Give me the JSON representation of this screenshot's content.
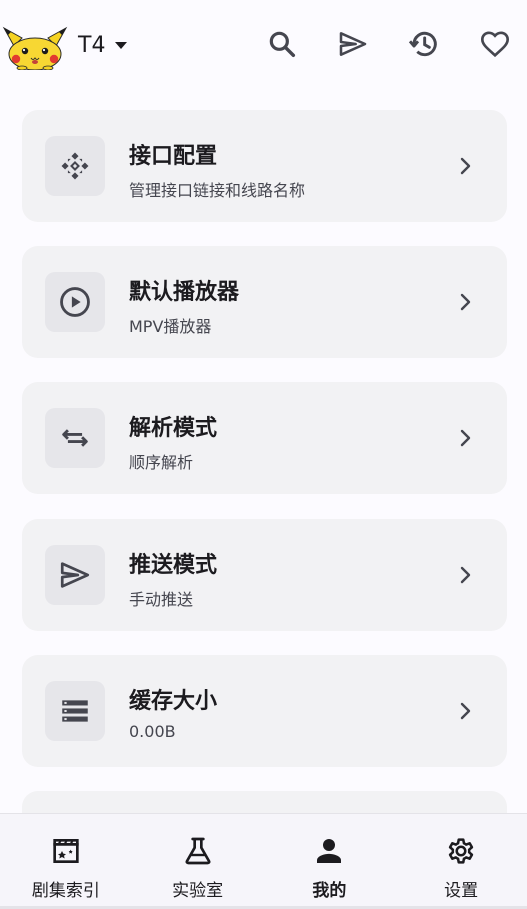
{
  "header": {
    "source_name": "T4",
    "logo_icon": "pikachu-logo",
    "actions": [
      {
        "icon": "search-icon"
      },
      {
        "icon": "send-icon"
      },
      {
        "icon": "history-icon"
      },
      {
        "icon": "heart-icon"
      }
    ]
  },
  "settings": [
    {
      "title": "接口配置",
      "subtitle": "管理接口链接和线路名称",
      "icon": "api-config-icon"
    },
    {
      "title": "默认播放器",
      "subtitle": "MPV播放器",
      "icon": "play-circle-icon"
    },
    {
      "title": "解析模式",
      "subtitle": "顺序解析",
      "icon": "swap-arrows-icon"
    },
    {
      "title": "推送模式",
      "subtitle": "手动推送",
      "icon": "send-icon"
    },
    {
      "title": "缓存大小",
      "subtitle": "0.00B",
      "icon": "storage-list-icon"
    }
  ],
  "bottom_nav": [
    {
      "label": "剧集索引",
      "icon": "movie-clapper-icon",
      "active": false
    },
    {
      "label": "实验室",
      "icon": "flask-icon",
      "active": false
    },
    {
      "label": "我的",
      "icon": "person-icon",
      "active": true
    },
    {
      "label": "设置",
      "icon": "gear-icon",
      "active": false
    }
  ],
  "colors": {
    "background": "#fcfbff",
    "card": "#f2f2f4",
    "icon_box": "#e6e6ea",
    "text_primary": "#1c1b1f",
    "text_secondary": "#45464f",
    "icon": "#45464f",
    "nav_bg": "#f6f5fa"
  }
}
